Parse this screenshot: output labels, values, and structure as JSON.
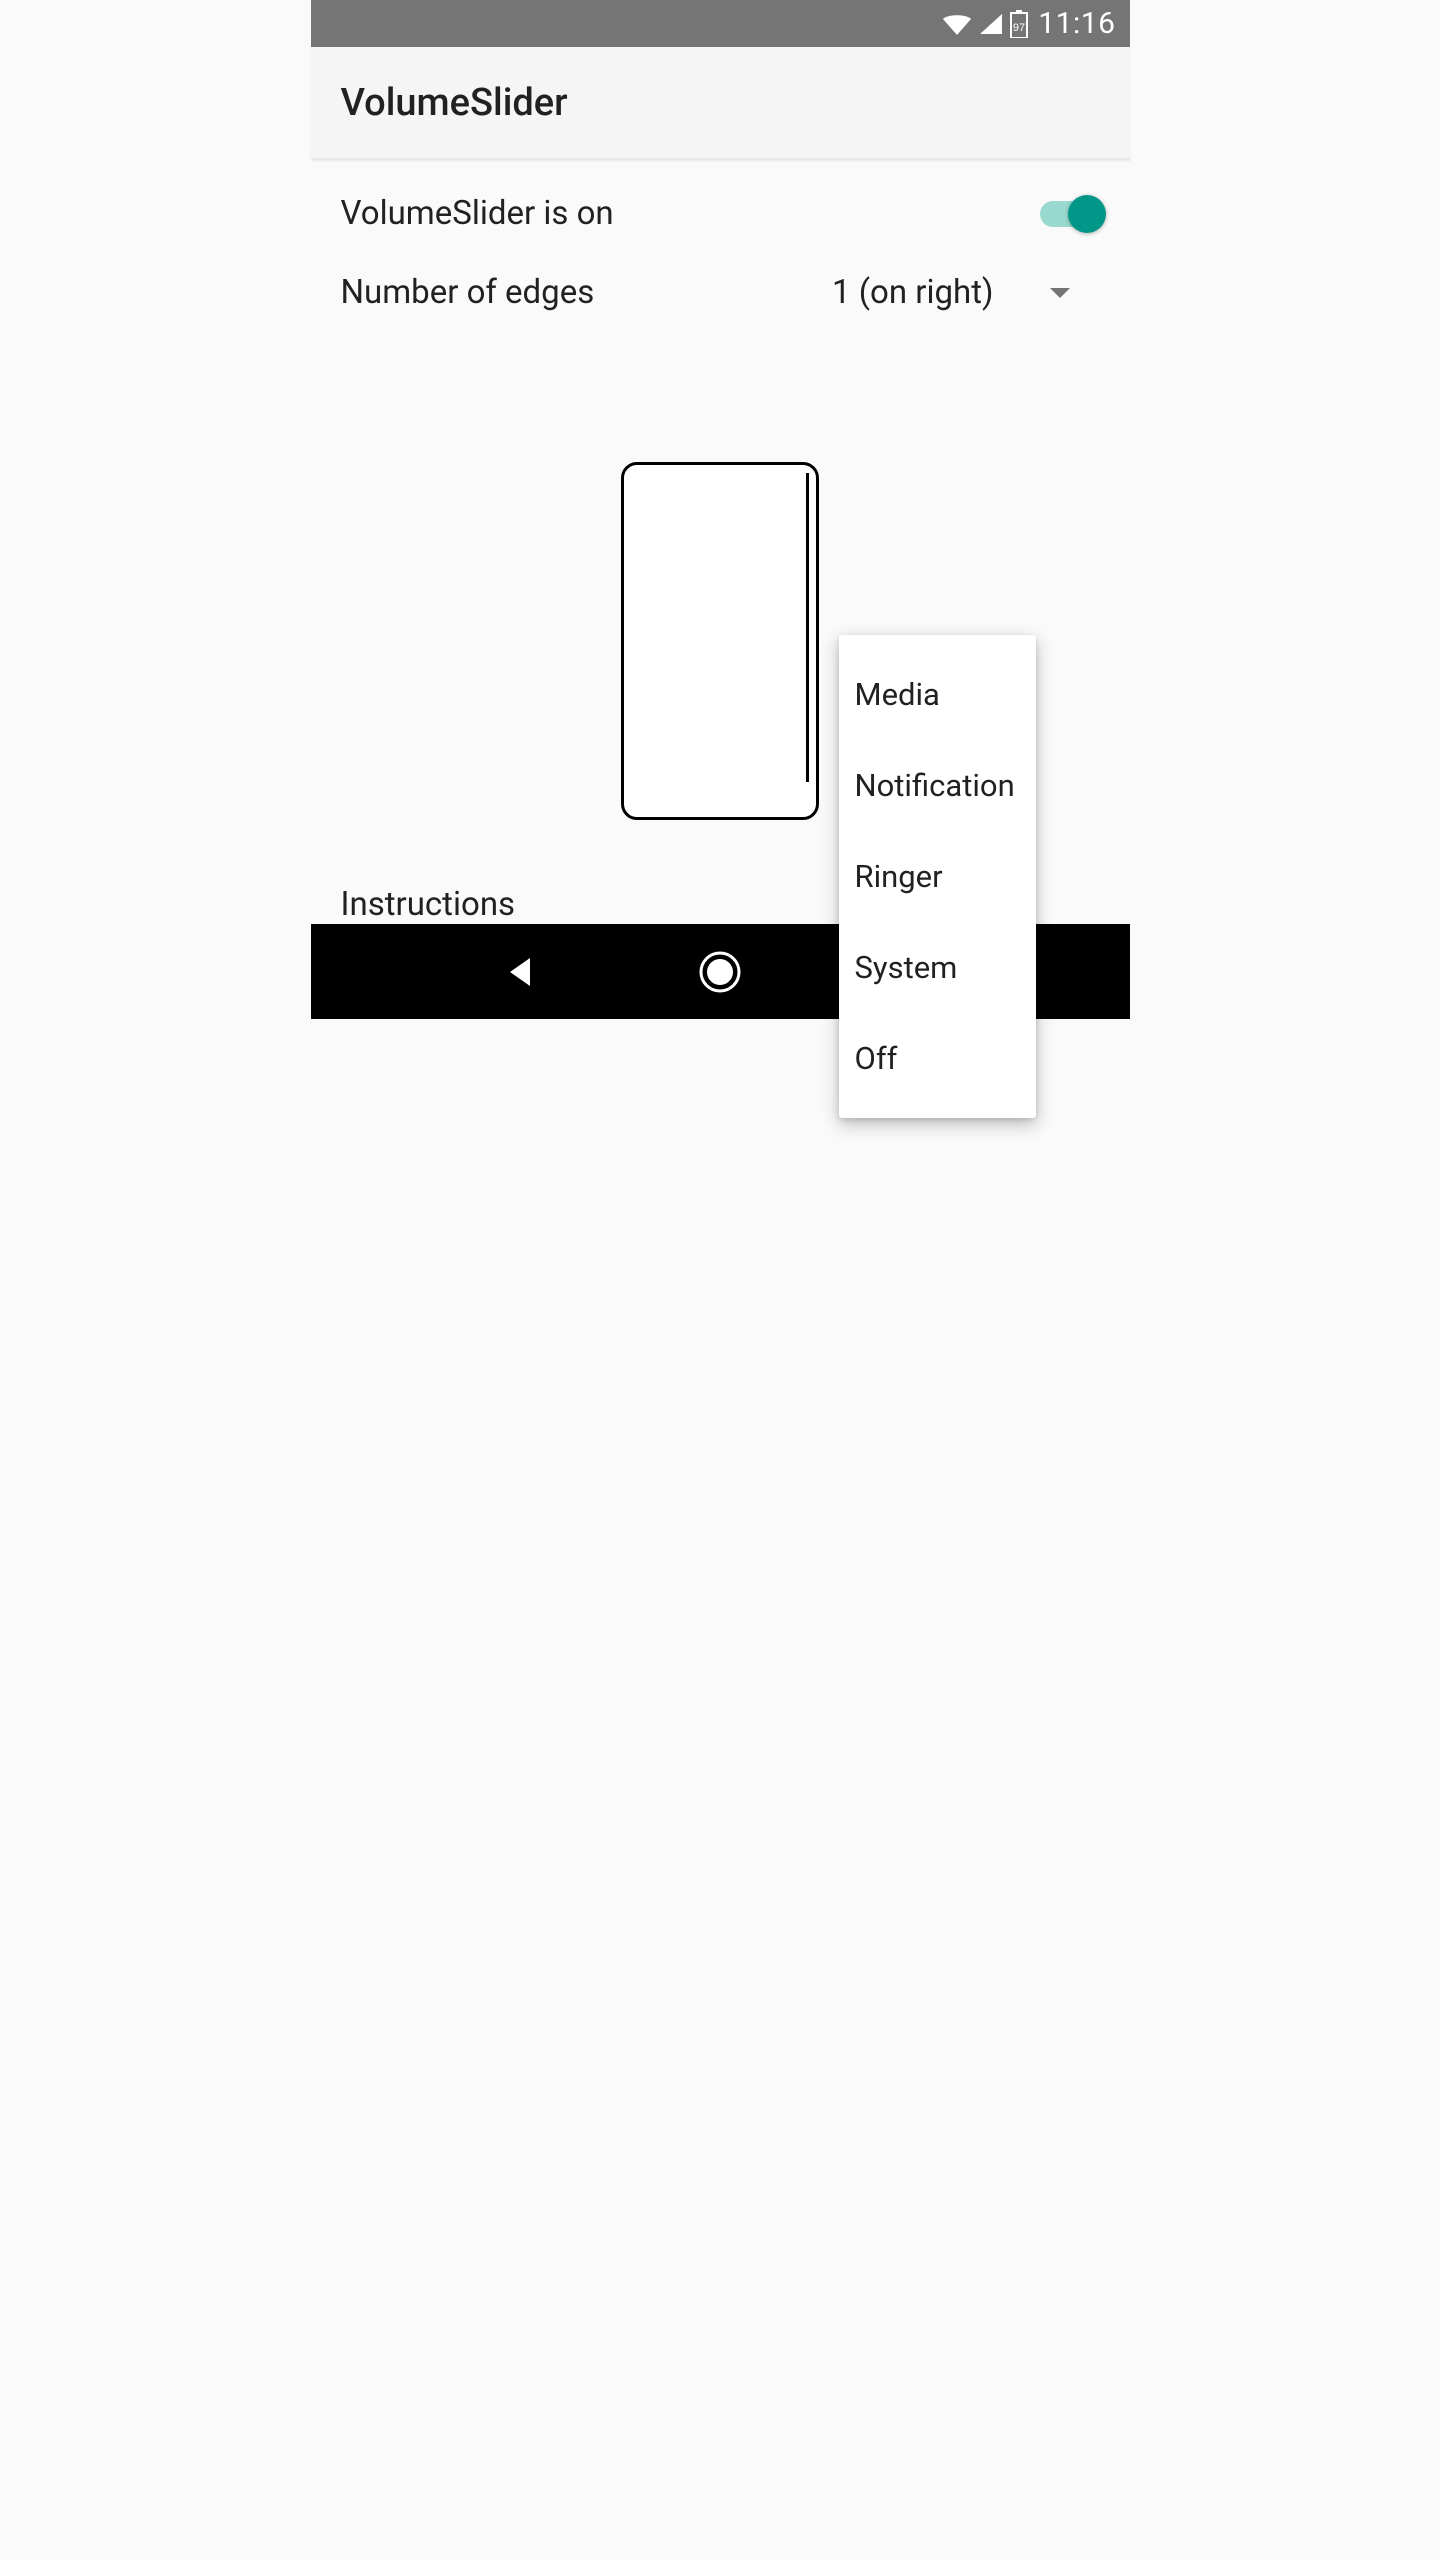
{
  "status_bar": {
    "battery_level": "97",
    "time": "11:16"
  },
  "app_bar": {
    "title": "VolumeSlider"
  },
  "settings": {
    "enabled_label": "VolumeSlider is on",
    "enabled_value": true,
    "edges_label": "Number of edges",
    "edges_selected": "1 (on right)"
  },
  "instructions_label": "Instructions",
  "popup": {
    "items": [
      "Media",
      "Notification",
      "Ringer",
      "System",
      "Off"
    ]
  },
  "colors": {
    "accent": "#009688",
    "accent_track": "#99d9cf",
    "status_bar_bg": "#757575",
    "app_bar_bg": "#f5f5f5",
    "background": "#fafafa",
    "text_primary": "#212121"
  }
}
